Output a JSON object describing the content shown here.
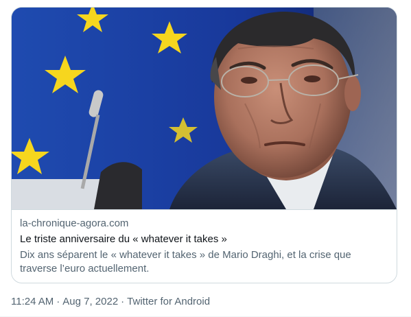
{
  "card": {
    "image_alt": "Mario Draghi in front of the European flag",
    "domain": "la-chronique-agora.com",
    "title": "Le triste anniversaire du « whatever it takes »",
    "description": "Dix ans séparent le « whatever it takes » de Mario Draghi, et la crise que traverse l’euro actuellement."
  },
  "tweet_meta": {
    "time": "11:24 AM",
    "date": "Aug 7, 2022",
    "source": "Twitter for Android",
    "separator": "·"
  },
  "colors": {
    "flag_blue": "#1c3f9a",
    "star_yellow": "#f6d61e",
    "border": "#cfd9de",
    "secondary_text": "#536471"
  }
}
